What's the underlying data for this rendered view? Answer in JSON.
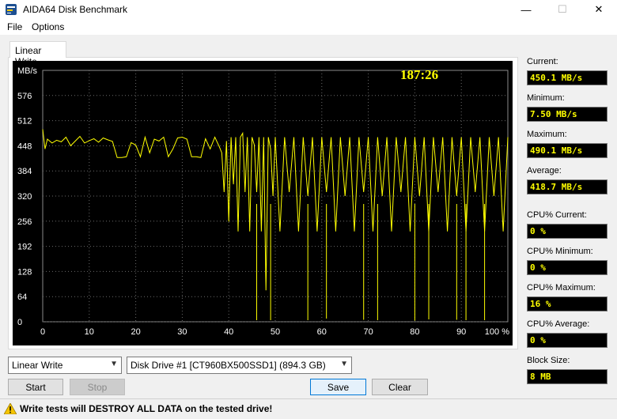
{
  "window": {
    "title": "AIDA64 Disk Benchmark",
    "minimize": "—",
    "maximize": "☐",
    "close": "✕"
  },
  "menu": {
    "file": "File",
    "options": "Options"
  },
  "tab": {
    "label": "Linear Write"
  },
  "chart": {
    "timer": "187:26"
  },
  "chart_data": {
    "type": "line",
    "title": "",
    "ylabel": "MB/s",
    "xlabel": "",
    "ylim": [
      0,
      640
    ],
    "xlim": [
      0,
      100
    ],
    "y_ticks": [
      "0",
      "64",
      "128",
      "192",
      "256",
      "320",
      "384",
      "448",
      "512",
      "576"
    ],
    "x_ticks": [
      "0",
      "10",
      "20",
      "30",
      "40",
      "50",
      "60",
      "70",
      "80",
      "90",
      "100 %"
    ],
    "grid": true,
    "series": [
      {
        "color": "#ffff00",
        "x": [
          0,
          0.5,
          1,
          2,
          3,
          4,
          5,
          6,
          7,
          8,
          9,
          10,
          11,
          12,
          13,
          14,
          15,
          16,
          17,
          18,
          19,
          20,
          21,
          22,
          23,
          24,
          25,
          26,
          27,
          28,
          29,
          30,
          31,
          32,
          33,
          34,
          35,
          36,
          37,
          38,
          38.5,
          39,
          39.5,
          40,
          40.5,
          41,
          41.5,
          42,
          42.5,
          43,
          43.5,
          44,
          44.5,
          45,
          45.5,
          46,
          46.5,
          47,
          47.5,
          48,
          48.5,
          49,
          49.5,
          50,
          51,
          52,
          53,
          54,
          55,
          56,
          57,
          58,
          59,
          60,
          61,
          62,
          63,
          64,
          65,
          66,
          67,
          68,
          69,
          70,
          71,
          72,
          73,
          74,
          75,
          76,
          77,
          78,
          79,
          80,
          81,
          82,
          83,
          84,
          85,
          86,
          87,
          88,
          89,
          90,
          91,
          92,
          93,
          94,
          95,
          96,
          97,
          98,
          99,
          100
        ],
        "y": [
          490,
          440,
          465,
          455,
          462,
          458,
          470,
          448,
          460,
          472,
          455,
          461,
          466,
          457,
          468,
          463,
          459,
          418,
          418,
          420,
          456,
          450,
          420,
          470,
          430,
          465,
          460,
          470,
          420,
          440,
          468,
          470,
          465,
          420,
          420,
          418,
          466,
          440,
          470,
          445,
          430,
          330,
          460,
          255,
          470,
          350,
          470,
          230,
          470,
          480,
          330,
          470,
          230,
          470,
          450,
          330,
          470,
          230,
          470,
          80,
          470,
          440,
          320,
          470,
          230,
          470,
          330,
          470,
          230,
          470,
          320,
          470,
          230,
          470,
          330,
          470,
          230,
          470,
          320,
          470,
          230,
          470,
          330,
          470,
          230,
          470,
          320,
          470,
          230,
          470,
          330,
          470,
          230,
          470,
          320,
          470,
          230,
          470,
          330,
          470,
          230,
          470,
          320,
          470,
          230,
          470,
          330,
          470,
          230,
          470,
          320,
          470,
          230,
          470
        ]
      }
    ],
    "dips": [
      {
        "x": 46,
        "y": 4
      },
      {
        "x": 49,
        "y": 4
      },
      {
        "x": 57,
        "y": 4
      },
      {
        "x": 61,
        "y": 8
      },
      {
        "x": 69,
        "y": 5
      },
      {
        "x": 72,
        "y": 4
      },
      {
        "x": 80,
        "y": 3
      },
      {
        "x": 83,
        "y": 6
      },
      {
        "x": 89,
        "y": 5
      },
      {
        "x": 91,
        "y": 4
      },
      {
        "x": 95,
        "y": 4
      }
    ]
  },
  "stats": {
    "current": {
      "label": "Current:",
      "value": "450.1 MB/s"
    },
    "minimum": {
      "label": "Minimum:",
      "value": "7.50 MB/s"
    },
    "maximum": {
      "label": "Maximum:",
      "value": "490.1 MB/s"
    },
    "average": {
      "label": "Average:",
      "value": "418.7 MB/s"
    },
    "cpu_current": {
      "label": "CPU% Current:",
      "value": "0 %"
    },
    "cpu_minimum": {
      "label": "CPU% Minimum:",
      "value": "0 %"
    },
    "cpu_maximum": {
      "label": "CPU% Maximum:",
      "value": "16 %"
    },
    "cpu_average": {
      "label": "CPU% Average:",
      "value": "0 %"
    },
    "block_size": {
      "label": "Block Size:",
      "value": "8 MB"
    }
  },
  "controls": {
    "test_select": "Linear Write",
    "drive_select": "Disk Drive #1  [CT960BX500SSD1]  (894.3 GB)",
    "start": "Start",
    "stop": "Stop",
    "save": "Save",
    "clear": "Clear"
  },
  "warning": {
    "text": "Write tests will DESTROY ALL DATA on the tested drive!"
  }
}
